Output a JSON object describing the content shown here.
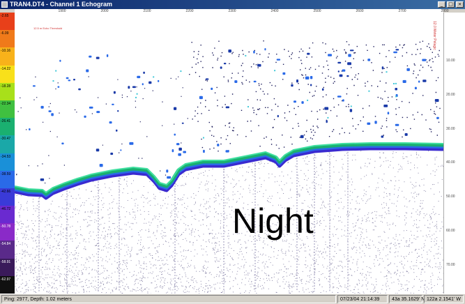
{
  "window": {
    "title": "TRAN4.DT4 - Channel 1  Echogram"
  },
  "x_axis": {
    "ticks": [
      "1900",
      "2000",
      "2100",
      "2200",
      "2300",
      "2400",
      "2500",
      "2600",
      "2700",
      "2800"
    ]
  },
  "depth_axis": {
    "ticks": [
      "10.00",
      "20.00",
      "30.00",
      "40.00",
      "50.00",
      "60.00",
      "70.00"
    ],
    "side_label": "12.0 Meter Pelagic"
  },
  "plot": {
    "corner_label": "12.5 m Echo Threshold"
  },
  "color_scale": {
    "labels": [
      "-2.65",
      "-6.09",
      "-10.16",
      "-14.22",
      "-18.28",
      "-22.34",
      "-26.41",
      "-30.47",
      "-34.53",
      "-38.59",
      "-42.66",
      "-46.72",
      "-50.78",
      "-54.84",
      "-58.91",
      "-62.97"
    ],
    "colors": [
      "#e8401a",
      "#f07a1a",
      "#f8b21a",
      "#f8e01a",
      "#a8e01a",
      "#40c040",
      "#1ab070",
      "#1aa8a8",
      "#1a90d8",
      "#2a6ae8",
      "#3a3ad8",
      "#6a2ad0",
      "#8a2ac8",
      "#5a2a8a",
      "#3a1a5a",
      "#101010"
    ]
  },
  "overlay": {
    "caption": "Night"
  },
  "status": {
    "ping": "Ping: 2977, Depth: 1.02 meters",
    "datetime": "07/23/04 21:14:39",
    "latitude": "43a 35.1629' N",
    "longitude": "122a 2.1541' W"
  }
}
